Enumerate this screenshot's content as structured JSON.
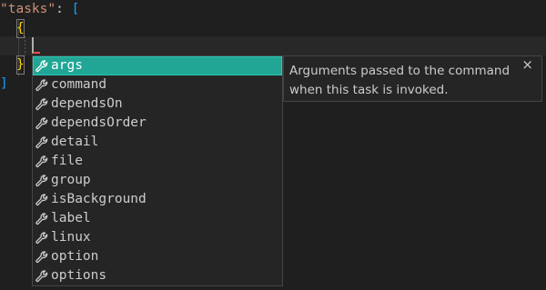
{
  "editor": {
    "key_quote_open": "\"",
    "key_text": "tasks",
    "key_quote_close": "\"",
    "colon": ": ",
    "array_open": "[",
    "object_open": "{",
    "object_close": "}",
    "array_close": "]"
  },
  "suggest": {
    "items": [
      {
        "label": "args",
        "icon": "wrench-icon",
        "selected": true
      },
      {
        "label": "command",
        "icon": "wrench-icon"
      },
      {
        "label": "dependsOn",
        "icon": "wrench-icon"
      },
      {
        "label": "dependsOrder",
        "icon": "wrench-icon"
      },
      {
        "label": "detail",
        "icon": "wrench-icon"
      },
      {
        "label": "file",
        "icon": "wrench-icon"
      },
      {
        "label": "group",
        "icon": "wrench-icon"
      },
      {
        "label": "isBackground",
        "icon": "wrench-icon"
      },
      {
        "label": "label",
        "icon": "wrench-icon"
      },
      {
        "label": "linux",
        "icon": "wrench-icon"
      },
      {
        "label": "option",
        "icon": "wrench-icon"
      },
      {
        "label": "options",
        "icon": "wrench-icon"
      }
    ]
  },
  "details": {
    "doc": "Arguments passed to the command when this task is invoked.",
    "close_glyph": "×"
  },
  "colors": {
    "background": "#1f1f1f",
    "selection": "#21a695",
    "key": "#ce9178",
    "bracket_blue": "#179fff",
    "bracket_gold": "#ffd700"
  }
}
